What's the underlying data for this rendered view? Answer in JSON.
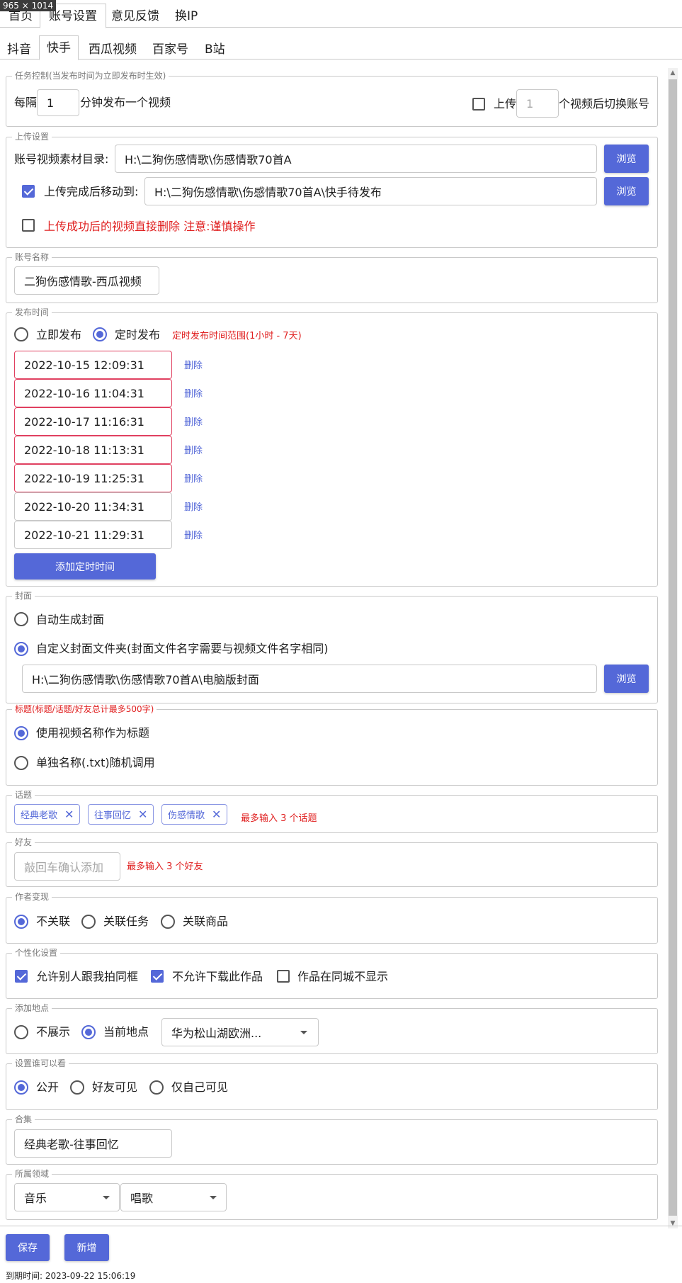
{
  "window_dims": "965 × 1014",
  "top_tabs": [
    "首页",
    "账号设置",
    "意见反馈",
    "换IP"
  ],
  "sub_tabs": [
    "抖音",
    "快手",
    "西瓜视频",
    "百家号",
    "B站"
  ],
  "task": {
    "legend": "任务控制(当发布时间为立即发布时生效)",
    "every_label": "每隔",
    "every_value": "1",
    "every_suffix": "分钟发布一个视频",
    "switch_label": "上传",
    "switch_placeholder": "1",
    "switch_suffix": "个视频后切换账号"
  },
  "upload": {
    "legend": "上传设置",
    "dir_label": "账号视频素材目录:",
    "dir_value": "H:\\二狗伤感情歌\\伤感情歌70首A",
    "browse": "浏览",
    "move_label": "上传完成后移动到:",
    "move_value": "H:\\二狗伤感情歌\\伤感情歌70首A\\快手待发布",
    "delete_label": "上传成功后的视频直接删除 注意:谨慎操作"
  },
  "account": {
    "legend": "账号名称",
    "value": "二狗伤感情歌-西瓜视频"
  },
  "publish": {
    "legend": "发布时间",
    "now_label": "立即发布",
    "scheduled_label": "定时发布",
    "range_hint": "定时发布时间范围(1小时 - 7天)",
    "delete_label": "删除",
    "times": [
      "2022-10-15 12:09:31",
      "2022-10-16 11:04:31",
      "2022-10-17 11:16:31",
      "2022-10-18 11:13:31",
      "2022-10-19 11:25:31",
      "2022-10-20 11:34:31",
      "2022-10-21 11:29:31"
    ],
    "add_button": "添加定时时间"
  },
  "cover": {
    "legend": "封面",
    "auto_label": "自动生成封面",
    "custom_label": "自定义封面文件夹(封面文件名字需要与视频文件名字相同)",
    "path_value": "H:\\二狗伤感情歌\\伤感情歌70首A\\电脑版封面",
    "browse": "浏览"
  },
  "title": {
    "legend": "标题(标题/话题/好友总计最多500字)",
    "use_video_name": "使用视频名称作为标题",
    "random_txt": "单独名称(.txt)随机调用"
  },
  "topics": {
    "legend": "话题",
    "tags": [
      "经典老歌",
      "往事回忆",
      "伤感情歌"
    ],
    "hint": "最多输入 3 个话题"
  },
  "friends": {
    "legend": "好友",
    "placeholder": "敲回车确认添加",
    "hint": "最多输入 3 个好友"
  },
  "monetize": {
    "legend": "作者变现",
    "options": [
      "不关联",
      "关联任务",
      "关联商品"
    ]
  },
  "personal": {
    "legend": "个性化设置",
    "options": [
      "允许别人跟我拍同框",
      "不允许下载此作品",
      "作品在同城不显示"
    ]
  },
  "location": {
    "legend": "添加地点",
    "hide_label": "不展示",
    "current_label": "当前地点",
    "selected": "华为松山湖欧洲..."
  },
  "visibility": {
    "legend": "设置谁可以看",
    "options": [
      "公开",
      "好友可见",
      "仅自己可见"
    ]
  },
  "collection": {
    "legend": "合集",
    "value": "经典老歌-往事回忆"
  },
  "domain": {
    "legend": "所属领域",
    "primary": "音乐",
    "secondary": "唱歌"
  },
  "footer": {
    "save": "保存",
    "add": "新增",
    "expire_label": "到期时间:",
    "expire_value": "2023-09-22 15:06:19"
  },
  "colors": {
    "accent": "#5468d8",
    "warning": "#e02020",
    "error_border": "#e04060"
  }
}
